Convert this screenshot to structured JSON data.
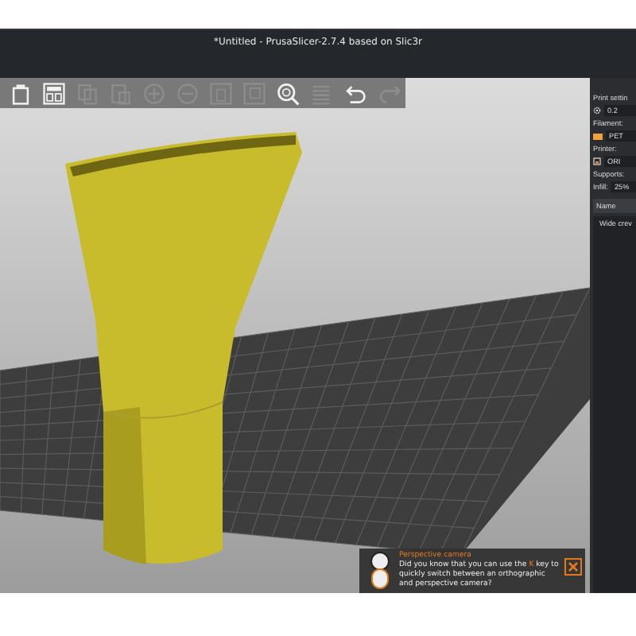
{
  "window": {
    "title": "*Untitled - PrusaSlicer-2.7.4 based on Slic3r"
  },
  "toolbar": [
    {
      "kind": "delete_all",
      "disabled": false
    },
    {
      "kind": "arrange",
      "disabled": false
    },
    {
      "kind": "copy",
      "disabled": true
    },
    {
      "kind": "paste",
      "disabled": true
    },
    {
      "kind": "plus",
      "disabled": true
    },
    {
      "kind": "minus",
      "disabled": true
    },
    {
      "kind": "split_objects",
      "disabled": true
    },
    {
      "kind": "split_parts",
      "disabled": true
    },
    {
      "kind": "search",
      "disabled": false
    },
    {
      "kind": "layers",
      "disabled": true
    },
    {
      "kind": "undo",
      "disabled": false
    },
    {
      "kind": "redo",
      "disabled": true
    }
  ],
  "sidebar": {
    "print_label": "Print settin",
    "print_value": "0.2",
    "filament_label": "Filament:",
    "filament_value": "PET",
    "filament": {
      "color": "#f0a040"
    },
    "printer_label": "Printer:",
    "printer_value": "ORI",
    "supports_label": "Supports:",
    "infill_label": "Infill:",
    "infill_value": "25%",
    "name_header": "Name",
    "object_name": "Wide crev"
  },
  "notification": {
    "title": "Perspective camera",
    "text_before": "Did you know that you can use the ",
    "key": "K",
    "text_after": " key to quickly switch between an orthographic and perspective camera?"
  }
}
